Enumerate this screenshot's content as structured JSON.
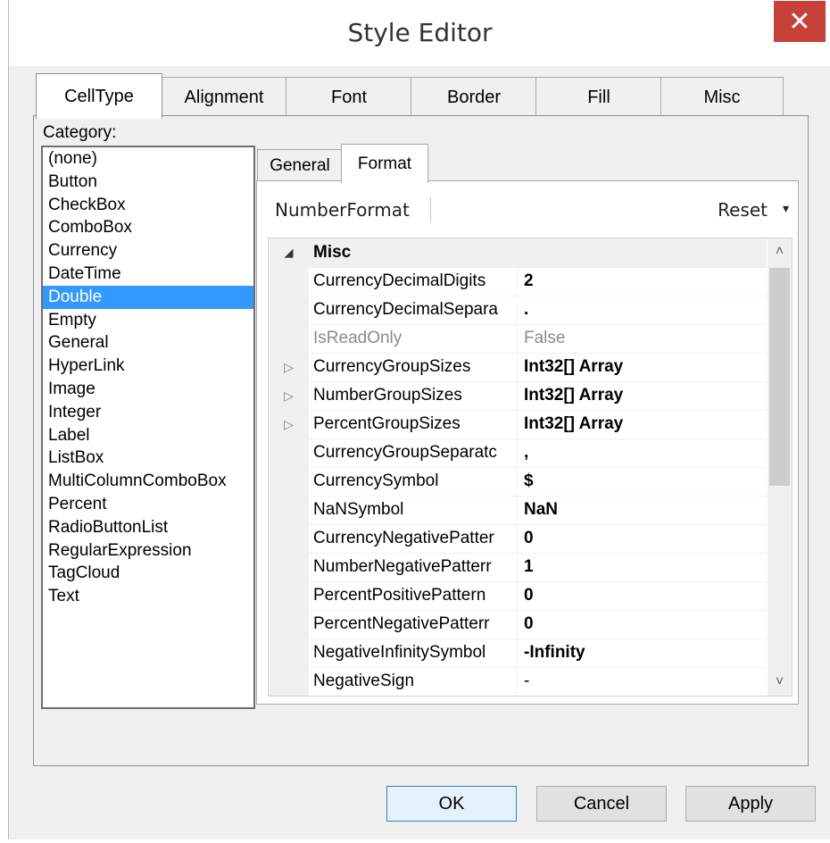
{
  "window": {
    "title": "Style Editor",
    "close_glyph": "✕"
  },
  "tabs": [
    {
      "label": "CellType",
      "active": true
    },
    {
      "label": "Alignment",
      "active": false
    },
    {
      "label": "Font",
      "active": false
    },
    {
      "label": "Border",
      "active": false
    },
    {
      "label": "Fill",
      "active": false
    },
    {
      "label": "Misc",
      "active": false
    }
  ],
  "category": {
    "label": "Category:",
    "selected": "Double",
    "items": [
      "(none)",
      "Button",
      "CheckBox",
      "ComboBox",
      "Currency",
      "DateTime",
      "Double",
      "Empty",
      "General",
      "HyperLink",
      "Image",
      "Integer",
      "Label",
      "ListBox",
      "MultiColumnComboBox",
      "Percent",
      "RadioButtonList",
      "RegularExpression",
      "TagCloud",
      "Text"
    ]
  },
  "inner_tabs": [
    {
      "label": "General",
      "active": false
    },
    {
      "label": "Format",
      "active": true
    }
  ],
  "property_grid": {
    "object_name": "NumberFormat",
    "reset_label": "Reset",
    "reset_arrow": "▾",
    "scroll_up": "˄",
    "scroll_down": "˅",
    "rows": [
      {
        "name": "Misc",
        "value": "",
        "kind": "category",
        "glyph": "◢"
      },
      {
        "name": "CurrencyDecimalDigits",
        "value": "2",
        "bold": true
      },
      {
        "name": "CurrencyDecimalSepara",
        "value": ".",
        "bold": true
      },
      {
        "name": "IsReadOnly",
        "value": "False",
        "readonly": true
      },
      {
        "name": "CurrencyGroupSizes",
        "value": "Int32[] Array",
        "bold": true,
        "glyph": "▷"
      },
      {
        "name": "NumberGroupSizes",
        "value": "Int32[] Array",
        "bold": true,
        "glyph": "▷"
      },
      {
        "name": "PercentGroupSizes",
        "value": "Int32[] Array",
        "bold": true,
        "glyph": "▷"
      },
      {
        "name": "CurrencyGroupSeparatc",
        "value": ",",
        "bold": true
      },
      {
        "name": "CurrencySymbol",
        "value": "$",
        "bold": true
      },
      {
        "name": "NaNSymbol",
        "value": "NaN",
        "bold": true
      },
      {
        "name": "CurrencyNegativePatter",
        "value": "0",
        "bold": true
      },
      {
        "name": "NumberNegativePatterr",
        "value": "1",
        "bold": true
      },
      {
        "name": "PercentPositivePattern",
        "value": "0",
        "bold": true
      },
      {
        "name": "PercentNegativePatterr",
        "value": "0",
        "bold": true
      },
      {
        "name": "NegativeInfinitySymbol",
        "value": "-Infinity",
        "bold": true
      },
      {
        "name": "NegativeSign",
        "value": "-",
        "bold": false
      }
    ]
  },
  "buttons": {
    "ok": "OK",
    "cancel": "Cancel",
    "apply": "Apply"
  },
  "colors": {
    "selection": "#3399ff",
    "close": "#c7403a"
  }
}
